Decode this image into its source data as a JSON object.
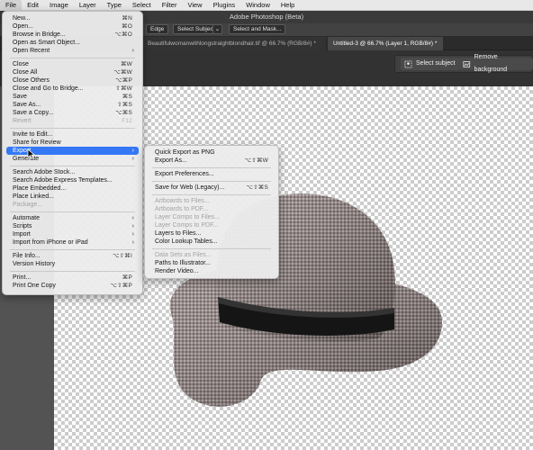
{
  "menubar": {
    "items": [
      "File",
      "Edit",
      "Image",
      "Layer",
      "Type",
      "Select",
      "Filter",
      "View",
      "Plugins",
      "Window",
      "Help"
    ]
  },
  "app": {
    "title": "Adobe Photoshop (Beta)"
  },
  "options": {
    "edge_label": "Edge",
    "select_subject_label": "Select Subject",
    "select_mask_label": "Select and Mask..."
  },
  "tabs": [
    {
      "label": "Beautifulwomanwithlongstraightblondhair.tif @ 66.7% (RGB/8#) *"
    },
    {
      "label": "Untitled-3 @ 66.7% (Layer 1, RGB/8#) *"
    }
  ],
  "context_bar": {
    "select_subject": "Select subject",
    "remove_background": "Remove background"
  },
  "file_menu": {
    "items": [
      {
        "label": "New...",
        "shortcut": "⌘N"
      },
      {
        "label": "Open...",
        "shortcut": "⌘O"
      },
      {
        "label": "Browse in Bridge...",
        "shortcut": "⌥⌘O"
      },
      {
        "label": "Open as Smart Object...",
        "shortcut": ""
      },
      {
        "label": "Open Recent",
        "shortcut": ""
      },
      {
        "label": "Close",
        "shortcut": "⌘W"
      },
      {
        "label": "Close All",
        "shortcut": "⌥⌘W"
      },
      {
        "label": "Close Others",
        "shortcut": "⌥⌘P"
      },
      {
        "label": "Close and Go to Bridge...",
        "shortcut": "⇧⌘W"
      },
      {
        "label": "Save",
        "shortcut": "⌘S"
      },
      {
        "label": "Save As...",
        "shortcut": "⇧⌘S"
      },
      {
        "label": "Save a Copy...",
        "shortcut": "⌥⌘S"
      },
      {
        "label": "Revert",
        "shortcut": "F12"
      },
      {
        "label": "Invite to Edit...",
        "shortcut": ""
      },
      {
        "label": "Share for Review",
        "shortcut": ""
      },
      {
        "label": "Export",
        "shortcut": ""
      },
      {
        "label": "Generate",
        "shortcut": ""
      },
      {
        "label": "Search Adobe Stock...",
        "shortcut": ""
      },
      {
        "label": "Search Adobe Express Templates...",
        "shortcut": ""
      },
      {
        "label": "Place Embedded...",
        "shortcut": ""
      },
      {
        "label": "Place Linked...",
        "shortcut": ""
      },
      {
        "label": "Package...",
        "shortcut": ""
      },
      {
        "label": "Automate",
        "shortcut": ""
      },
      {
        "label": "Scripts",
        "shortcut": ""
      },
      {
        "label": "Import",
        "shortcut": ""
      },
      {
        "label": "Import from iPhone or iPad",
        "shortcut": ""
      },
      {
        "label": "File Info...",
        "shortcut": "⌥⇧⌘I"
      },
      {
        "label": "Version History",
        "shortcut": ""
      },
      {
        "label": "Print...",
        "shortcut": "⌘P"
      },
      {
        "label": "Print One Copy",
        "shortcut": "⌥⇧⌘P"
      }
    ]
  },
  "export_menu": {
    "items": [
      {
        "label": "Quick Export as PNG",
        "shortcut": ""
      },
      {
        "label": "Export As...",
        "shortcut": "⌥⇧⌘W"
      },
      {
        "label": "Export Preferences...",
        "shortcut": ""
      },
      {
        "label": "Save for Web (Legacy)...",
        "shortcut": "⌥⇧⌘S"
      },
      {
        "label": "Artboards to Files...",
        "shortcut": ""
      },
      {
        "label": "Artboards to PDF...",
        "shortcut": ""
      },
      {
        "label": "Layer Comps to Files...",
        "shortcut": ""
      },
      {
        "label": "Layer Comps to PDF...",
        "shortcut": ""
      },
      {
        "label": "Layers to Files...",
        "shortcut": ""
      },
      {
        "label": "Color Lookup Tables...",
        "shortcut": ""
      },
      {
        "label": "Data Sets as Files...",
        "shortcut": ""
      },
      {
        "label": "Paths to Illustrator...",
        "shortcut": ""
      },
      {
        "label": "Render Video...",
        "shortcut": ""
      }
    ]
  },
  "colors": {
    "highlight": "#3478f6",
    "canvas_bg": "#535353"
  }
}
